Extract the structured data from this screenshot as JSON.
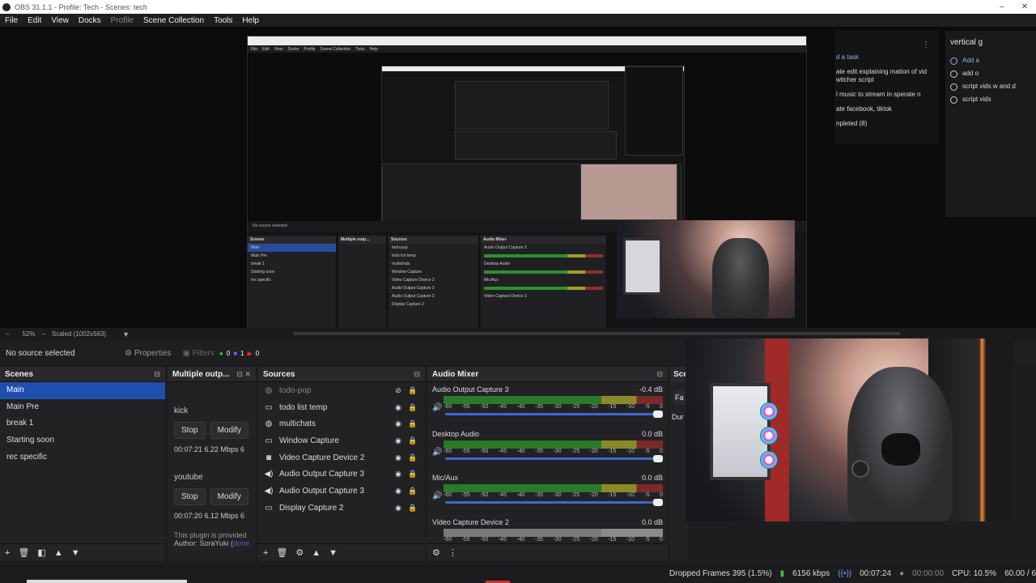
{
  "window": {
    "title": "OBS 31.1.1 - Profile: Tech - Scenes: tech",
    "min": "–",
    "close": "✕"
  },
  "menu": [
    "File",
    "Edit",
    "View",
    "Docks",
    "Profile",
    "Scene Collection",
    "Tools",
    "Help"
  ],
  "preview": {
    "nested_menu": [
      "File",
      "Edit",
      "View",
      "Docks",
      "Profile",
      "Scene Collection",
      "Tools",
      "Help"
    ],
    "nested_status": "No source selected",
    "nested_scenes": [
      "Main",
      "Main Pre",
      "break 1",
      "Starting soon",
      "rec specific"
    ],
    "nested_sources": [
      "todo-pop",
      "todo list temp",
      "multichats",
      "Window Capture",
      "Video Capture Device 2",
      "Audio Output Capture 3",
      "Audio Output Capture 3",
      "Display Capture 2"
    ],
    "nested_mixer": [
      "Audio Output Capture 3",
      "Desktop Audio",
      "Mic/Aux",
      "Video Capture Device 2"
    ],
    "todo_tasks": [
      "d a task",
      "ate edit explaining mation of vid witcher script",
      "l music to stream in sperate n",
      "ate facebook, tiktok",
      "npleted (8)"
    ],
    "todo_side_title": "vertical g",
    "todo_side_items": [
      "Add a",
      "add o",
      "script vids w and d",
      "script vids"
    ]
  },
  "status_row": {
    "zoom": "52%",
    "scale": "Scaled (1002x563)"
  },
  "source_bar": {
    "no_source": "No source selected",
    "properties": "Properties",
    "filters": "Filters",
    "counts": [
      "0",
      "1",
      "0"
    ]
  },
  "scenes": {
    "title": "Scenes",
    "items": [
      "Main",
      "Main Pre",
      "break 1",
      "Starting soon",
      "rec specific"
    ],
    "selected": 0
  },
  "multiple_output": {
    "title": "Multiple outp...",
    "targets": [
      {
        "name": "kick",
        "stop": "Stop",
        "modify": "Modify",
        "stats": "00:07:21  6.22 Mbps  6"
      },
      {
        "name": "youtube",
        "stop": "Stop",
        "modify": "Modify",
        "stats": "00:07:20  6.12 Mbps  6"
      }
    ],
    "footer_line1": "This plugin is provided",
    "footer_line2": "Author: SoraYuki (",
    "footer_link": "done"
  },
  "sources": {
    "title": "Sources",
    "items": [
      {
        "name": "todo-pop",
        "icon": "browser-icon",
        "hidden": true
      },
      {
        "name": "todo list temp",
        "icon": "window-icon",
        "hidden": false
      },
      {
        "name": "multichats",
        "icon": "browser-icon",
        "hidden": false
      },
      {
        "name": "Window Capture",
        "icon": "window-icon",
        "hidden": false
      },
      {
        "name": "Video Capture Device 2",
        "icon": "camera-icon",
        "hidden": false
      },
      {
        "name": "Audio Output Capture 3",
        "icon": "speaker-icon",
        "hidden": false
      },
      {
        "name": "Audio Output Capture 3",
        "icon": "speaker-icon",
        "hidden": false
      },
      {
        "name": "Display Capture 2",
        "icon": "monitor-icon",
        "hidden": false
      }
    ]
  },
  "audio_mixer": {
    "title": "Audio Mixer",
    "ticks": [
      "-60",
      "-55",
      "-50",
      "-45",
      "-40",
      "-35",
      "-30",
      "-25",
      "-20",
      "-15",
      "-10",
      "-5",
      "0"
    ],
    "channels": [
      {
        "name": "Audio Output Capture 3",
        "db": "-0.4 dB",
        "level": 0.97,
        "grey": false
      },
      {
        "name": "Desktop Audio",
        "db": "0.0 dB",
        "level": 1.0,
        "grey": false
      },
      {
        "name": "Mic/Aux",
        "db": "0.0 dB",
        "level": 1.0,
        "grey": false
      },
      {
        "name": "Video Capture Device 2",
        "db": "0.0 dB",
        "level": 1.0,
        "grey": true
      }
    ]
  },
  "scene_transitions": {
    "title": "Sce",
    "fade": "Fa",
    "duration": "Dur"
  },
  "statusbar": {
    "dropped": "Dropped Frames 395 (1.5%)",
    "bitrate": "6156 kbps",
    "live_time": "00:07:24",
    "rec_time": "00:00:00",
    "cpu": "CPU: 10.5%",
    "fps": "60.00 / 6"
  },
  "colors": {
    "accent": "#1f4fae",
    "meter_green": "#2a7a2a",
    "slider": "#3d68d1"
  }
}
